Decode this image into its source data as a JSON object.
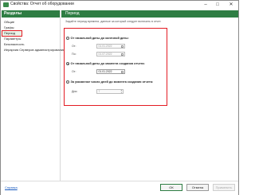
{
  "window": {
    "title": "Свойства: Отчет об оборудовании",
    "minimize": "–",
    "maximize": "□",
    "close": "✕"
  },
  "sidebar": {
    "header": "Разделы",
    "items": [
      {
        "label": "Общие"
      },
      {
        "label": "Графы"
      },
      {
        "label": "Период"
      },
      {
        "label": "Параметры"
      },
      {
        "label": "Безопасность"
      },
      {
        "label": "Иерархия Серверов администрирования"
      }
    ]
  },
  "main": {
    "header": "Период",
    "description": "Задайте период времени, данные за который следует включать в отчет.",
    "options": [
      {
        "label": "От начальной даты до конечной даты:",
        "checked": false,
        "fields": [
          {
            "label": "От:",
            "value": "01.01.2022"
          },
          {
            "label": "По:",
            "value": "01.07.2022"
          }
        ]
      },
      {
        "label": "От начальной даты до момента создания отчета:",
        "checked": true,
        "fields": [
          {
            "label": "От:",
            "value": "01.01.2022"
          }
        ]
      },
      {
        "label": "За указанное число дней до момента создания отчета:",
        "checked": false,
        "fields": [
          {
            "label": "Дни:",
            "value": "7"
          }
        ]
      }
    ]
  },
  "footer": {
    "help": "Справка",
    "ok": "ОК",
    "cancel": "Отмена",
    "apply": "Применить"
  }
}
